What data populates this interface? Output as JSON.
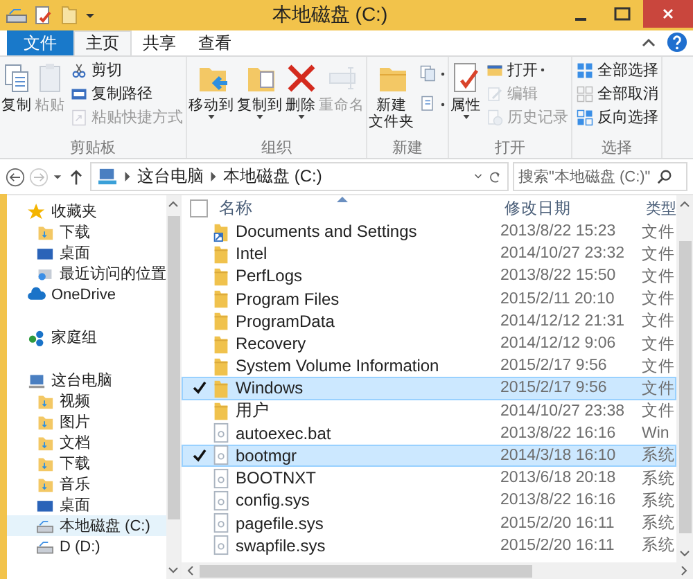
{
  "window": {
    "title": "本地磁盘 (C:)"
  },
  "tabs": [
    {
      "label": "文件",
      "kind": "file",
      "selected": false
    },
    {
      "label": "主页",
      "kind": "tab",
      "selected": true
    },
    {
      "label": "共享",
      "kind": "tab",
      "selected": false
    },
    {
      "label": "查看",
      "kind": "tab",
      "selected": false
    }
  ],
  "ribbon": [
    {
      "label": "剪贴板",
      "buttons": [
        {
          "kind": "large",
          "label": "复制",
          "disabled": false,
          "dropdown": false
        },
        {
          "kind": "large",
          "label": "粘贴",
          "disabled": true,
          "dropdown": false
        },
        {
          "kind": "small",
          "label": "剪切",
          "disabled": false,
          "dropdown": false
        },
        {
          "kind": "small",
          "label": "复制路径",
          "disabled": false,
          "dropdown": false
        },
        {
          "kind": "small",
          "label": "粘贴快捷方式",
          "disabled": true,
          "dropdown": false
        }
      ]
    },
    {
      "label": "组织",
      "buttons": [
        {
          "kind": "large",
          "label": "移动到",
          "disabled": false,
          "dropdown": true
        },
        {
          "kind": "large",
          "label": "复制到",
          "disabled": false,
          "dropdown": true
        },
        {
          "kind": "large",
          "label": "删除",
          "disabled": false,
          "dropdown": true
        },
        {
          "kind": "large",
          "label": "重命名",
          "disabled": true,
          "dropdown": false
        }
      ]
    },
    {
      "label": "新建",
      "buttons": [
        {
          "kind": "large",
          "lines": [
            "新建",
            "文件夹"
          ],
          "disabled": false,
          "dropdown": false
        },
        {
          "kind": "icon",
          "disabled": false,
          "dropdown": true
        },
        {
          "kind": "icon",
          "disabled": false,
          "dropdown": true
        }
      ]
    },
    {
      "label": "打开",
      "buttons": [
        {
          "kind": "large",
          "label": "属性",
          "disabled": false,
          "dropdown": true
        },
        {
          "kind": "small",
          "label": "打开",
          "disabled": false,
          "dropdown": true
        },
        {
          "kind": "small",
          "label": "编辑",
          "disabled": true,
          "dropdown": false
        },
        {
          "kind": "small",
          "label": "历史记录",
          "disabled": true,
          "dropdown": false
        }
      ]
    },
    {
      "label": "选择",
      "buttons": [
        {
          "kind": "small",
          "label": "全部选择",
          "disabled": false,
          "dropdown": false
        },
        {
          "kind": "small",
          "label": "全部取消",
          "disabled": false,
          "dropdown": false
        },
        {
          "kind": "small",
          "label": "反向选择",
          "disabled": false,
          "dropdown": false
        }
      ]
    }
  ],
  "address": {
    "path": [
      "这台电脑",
      "本地磁盘 (C:)"
    ],
    "search": {
      "placeholder": "搜索\"本地磁盘 (C:)\""
    }
  },
  "sidebar": {
    "items": [
      {
        "label": "收藏夹",
        "kind": "favorites",
        "selected": false,
        "children": [
          {
            "label": "下载",
            "kind": "folder",
            "selected": false
          },
          {
            "label": "桌面",
            "kind": "desktop",
            "selected": false
          },
          {
            "label": "最近访问的位置",
            "kind": "recent",
            "selected": false
          }
        ]
      },
      {
        "label": "OneDrive",
        "kind": "cloud",
        "selected": false
      },
      {
        "label": "家庭组",
        "kind": "homegroup",
        "selected": false
      },
      {
        "label": "这台电脑",
        "kind": "computer",
        "selected": false,
        "children": [
          {
            "label": "视频",
            "kind": "folder",
            "selected": false
          },
          {
            "label": "图片",
            "kind": "folder",
            "selected": false
          },
          {
            "label": "文档",
            "kind": "folder",
            "selected": false
          },
          {
            "label": "下载",
            "kind": "folder",
            "selected": false
          },
          {
            "label": "音乐",
            "kind": "folder",
            "selected": false
          },
          {
            "label": "桌面",
            "kind": "desktop",
            "selected": false
          },
          {
            "label": "本地磁盘 (C:)",
            "kind": "drive",
            "selected": true
          },
          {
            "label": "D (D:)",
            "kind": "drive",
            "selected": false
          }
        ]
      }
    ]
  },
  "table": {
    "columns": [
      "名称",
      "修改日期",
      "类型"
    ],
    "all_checked": false,
    "rows": [
      {
        "kind": "shortcut",
        "name": "Documents and Settings",
        "date": "2013/8/22 15:23",
        "type": "文件",
        "selected": false
      },
      {
        "kind": "folder",
        "name": "Intel",
        "date": "2014/10/27 23:32",
        "type": "文件",
        "selected": false
      },
      {
        "kind": "folder",
        "name": "PerfLogs",
        "date": "2013/8/22 15:50",
        "type": "文件",
        "selected": false
      },
      {
        "kind": "folder",
        "name": "Program Files",
        "date": "2015/2/11 20:10",
        "type": "文件",
        "selected": false
      },
      {
        "kind": "folder",
        "name": "ProgramData",
        "date": "2014/12/12 21:31",
        "type": "文件",
        "selected": false
      },
      {
        "kind": "folder",
        "name": "Recovery",
        "date": "2014/12/12 9:06",
        "type": "文件",
        "selected": false
      },
      {
        "kind": "folder",
        "name": "System Volume Information",
        "date": "2015/2/17 9:56",
        "type": "文件",
        "selected": false
      },
      {
        "kind": "folder",
        "name": "Windows",
        "date": "2015/2/17 9:56",
        "type": "文件",
        "selected": true
      },
      {
        "kind": "folder",
        "name": "用户",
        "date": "2014/10/27 23:38",
        "type": "文件",
        "selected": false
      },
      {
        "kind": "file",
        "name": "autoexec.bat",
        "date": "2013/8/22 16:16",
        "type": "Win",
        "selected": false
      },
      {
        "kind": "file",
        "name": "bootmgr",
        "date": "2014/3/18 16:10",
        "type": "系统",
        "selected": true
      },
      {
        "kind": "file",
        "name": "BOOTNXT",
        "date": "2013/6/18 20:18",
        "type": "系统",
        "selected": false
      },
      {
        "kind": "file",
        "name": "config.sys",
        "date": "2013/8/22 16:16",
        "type": "系统",
        "selected": false
      },
      {
        "kind": "file",
        "name": "pagefile.sys",
        "date": "2015/2/20 16:11",
        "type": "系统",
        "selected": false
      },
      {
        "kind": "file",
        "name": "swapfile.sys",
        "date": "2015/2/20 16:11",
        "type": "系统",
        "selected": false
      }
    ]
  }
}
